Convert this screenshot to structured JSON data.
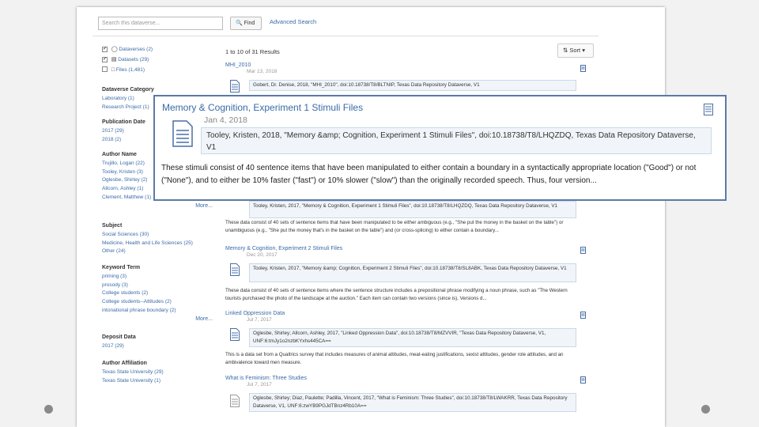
{
  "search": {
    "placeholder": "Search this dataverse...",
    "find_label": "Find",
    "advanced_label": "Advanced Search"
  },
  "type_filters": [
    {
      "label": "Dataverses (2)",
      "checked": true,
      "icon": "dataverse-icon"
    },
    {
      "label": "Datasets (29)",
      "checked": true,
      "icon": "dataset-icon"
    },
    {
      "label": "Files (1,481)",
      "checked": false,
      "icon": "file-icon"
    }
  ],
  "facets": {
    "dataverse_category": {
      "title": "Dataverse Category",
      "items": [
        "Laboratory (1)",
        "Research Project (1)"
      ]
    },
    "publication_date": {
      "title": "Publication Date",
      "items": [
        "2017 (29)",
        "2018 (2)"
      ]
    },
    "author_name": {
      "title": "Author Name",
      "items": [
        "Trujillo, Logan (22)",
        "Tooley, Kristen (3)",
        "Oglesbe, Shirley (2)",
        "Allcorn, Ashley (1)",
        "Clement, Matthew (1)"
      ],
      "more": "More..."
    },
    "subject": {
      "title": "Subject",
      "items": [
        "Social Sciences (30)",
        "Medicine, Health and Life Sciences (25)",
        "Other (24)"
      ]
    },
    "keyword_term": {
      "title": "Keyword Term",
      "items": [
        "priming (3)",
        "prosody (3)",
        "College students (2)",
        "College students--Attitudes (2)",
        "intonational phrase boundary (2)"
      ],
      "more": "More..."
    },
    "deposit_date": {
      "title": "Deposit Data",
      "items": [
        "2017 (29)"
      ]
    },
    "author_affiliation": {
      "title": "Author Affiliation",
      "items": [
        "Texas State University (29)",
        "Texas State University (1)"
      ]
    }
  },
  "results_header": {
    "count": "1 to 10 of 31 Results",
    "sort_label": "Sort"
  },
  "results": {
    "r1": {
      "title": "MHI_2010",
      "date": "Mar 13, 2018",
      "cite": "Gobert, Dr. Denise, 2018, \"MHI_2010\", doi:10.18738/T8/BLTNIP, Texas Data Repository Dataverse, V1"
    },
    "r2": {
      "cite": "Tooley, Kristen, 2017, \"Memory & Cognition, Experiment 1 Stimuli Files\", doi:10.18738/T8/LHQZDQ, Texas Data Repository Dataverse, V1",
      "desc": "These data consist of 40 sets of sentence items that have been manipulated to be either ambiguous (e.g., \"She put the money in the basket on the table\") or unambiguous (e.g., \"She put the money that's in the basket on the table\") and (or cross-splicing) to either contain a boundary..."
    },
    "r3": {
      "title": "Memory & Cognition, Experiment 2 Stimuli Files",
      "date": "Dec 20, 2017",
      "cite": "Tooley, Kristen, 2017, \"Memory &amp; Cognition, Experiment 2 Stimuli Files\", doi:10.18738/T8/SL8ABK, Texas Data Repository Dataverse, V1",
      "desc": "These data consist of 40 sets of sentence items where the sentence structure includes a prepositional phrase modifying a noun phrase, such as \"The Western tourists purchased the photo of the landscape at the auction.\" Each item can contain two versions (since is), Versions d..."
    },
    "r4": {
      "title": "Linked Oppression Data",
      "date": "Jul 7, 2017",
      "cite": "Oglesbe, Shirley; Allcorn, Ashley, 2017, \"Linked Oppression Data\", doi:10.18738/T8/MZVVIR, \"Texas Data Repository Dataverse, V1, UNF:6:tmJy1o2nzbKYxhs445CA==",
      "desc": "This is a data set from a Qualtrics survey that includes measures of animal attitudes, meat-eating justifications, sexist attitudes, gender role attitudes, and an ambivalence toward men measure."
    },
    "r5": {
      "title": "What is Feminism: Three Studies",
      "date": "Jul 7, 2017",
      "cite": "Oglesbe, Shirley; Diaz, Paulette; Padilla, Vincent, 2017, \"What is Feminism: Three Studies\", doi:10.18738/T8/LWAKRR, Texas Data Repository Dataverse, V1, UNF:6:zwYB9PGJdTBnz4Rb10A=="
    }
  },
  "zoom_card": {
    "title": "Memory & Cognition, Experiment 1 Stimuli Files",
    "date": "Jan 4, 2018",
    "cite": "Tooley, Kristen, 2018, \"Memory &amp; Cognition, Experiment 1 Stimuli Files\", doi:10.18738/T8/LHQZDQ, Texas Data Repository Dataverse, V1",
    "desc": "These stimuli consist of 40 sentence items that have been manipulated to either contain a boundary in a syntactically appropriate location (\"Good\") or not (\"None\"), and to either be 10% faster (\"fast\") or 10% slower (\"slow\") than the originally recorded speech. Thus, four version..."
  }
}
